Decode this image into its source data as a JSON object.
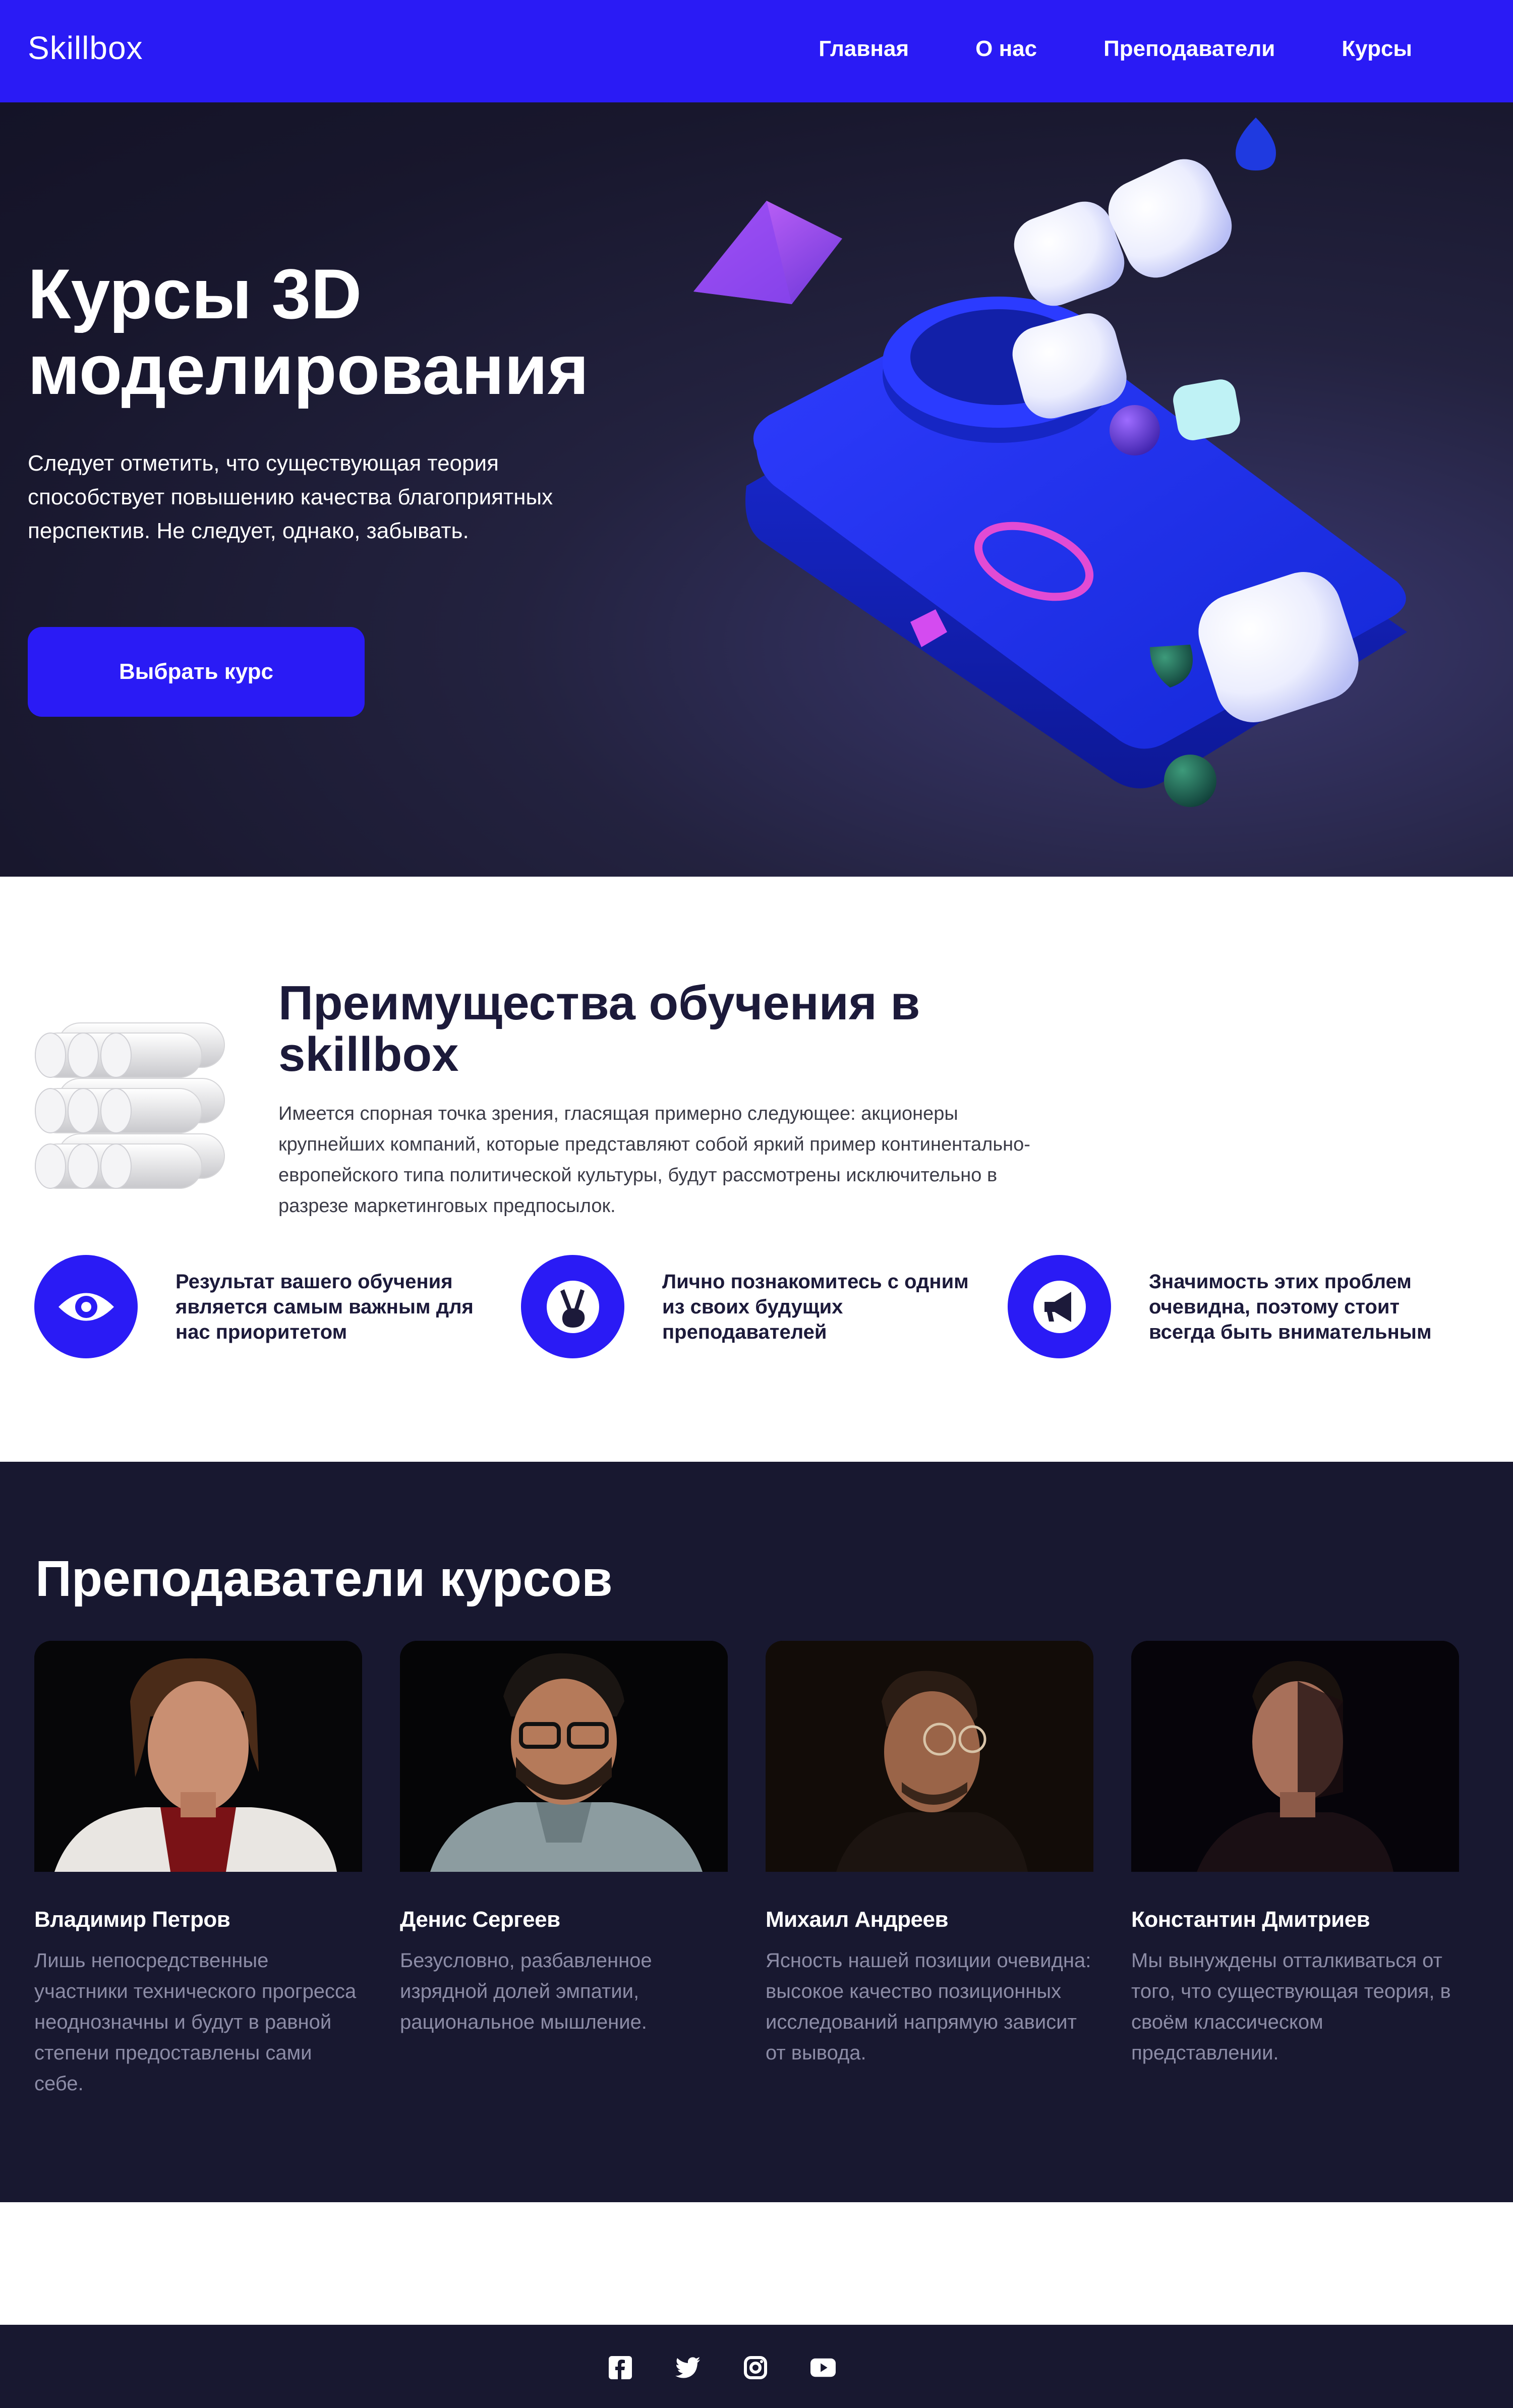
{
  "nav": {
    "logo": "Skillbox",
    "links": [
      "Главная",
      "О нас",
      "Преподаватели",
      "Курсы"
    ]
  },
  "hero": {
    "title": "Курсы 3D моделирования",
    "subtitle": "Следует отметить, что существующая теория способствует повышению качества благоприятных перспектив. Не следует, однако, забывать.",
    "button_label": "Выбрать курс"
  },
  "advantages": {
    "title": "Преимущества обучения в skillbox",
    "text": "Имеется спорная точка зрения, гласящая примерно следующее: акционеры крупнейших компаний, которые представляют собой яркий пример континентально-европейского типа политической культуры, будут рассмотрены исключительно в разрезе маркетинговых предпосылок.",
    "features": [
      {
        "icon": "eye-icon",
        "text": "Результат вашего обучения является самым важным для нас приоритетом"
      },
      {
        "icon": "victory-hand-icon",
        "text": "Лично познакомитесь с одним из своих будущих преподавателей"
      },
      {
        "icon": "megaphone-icon",
        "text": "Значимость этих проблем очевидна, поэтому стоит всегда быть внимательным"
      }
    ]
  },
  "teachers": {
    "title": "Преподаватели курсов",
    "cards": [
      {
        "name": "Владимир Петров",
        "desc": "Лишь непосредственные участники технического прогресса неоднозначны и будут в равной степени предоставлены сами себе."
      },
      {
        "name": "Денис Сергеев",
        "desc": "Безусловно, разбавленное изрядной долей эмпатии, рациональное мышление."
      },
      {
        "name": "Михаил Андреев",
        "desc": "Ясность нашей позиции очевидна: высокое качество позиционных исследований напрямую зависит от вывода."
      },
      {
        "name": "Константин Дмитриев",
        "desc": "Мы вынуждены отталкиваться от того, что существующая теория, в своём классическом представлении."
      }
    ]
  },
  "footer": {
    "socials": [
      "facebook-icon",
      "twitter-icon",
      "instagram-icon",
      "youtube-icon"
    ]
  },
  "colors": {
    "accent": "#2a1bf5",
    "dark_bg": "#181830",
    "hero_bg": "#1c1b33",
    "muted_text": "#8c8ca6"
  }
}
